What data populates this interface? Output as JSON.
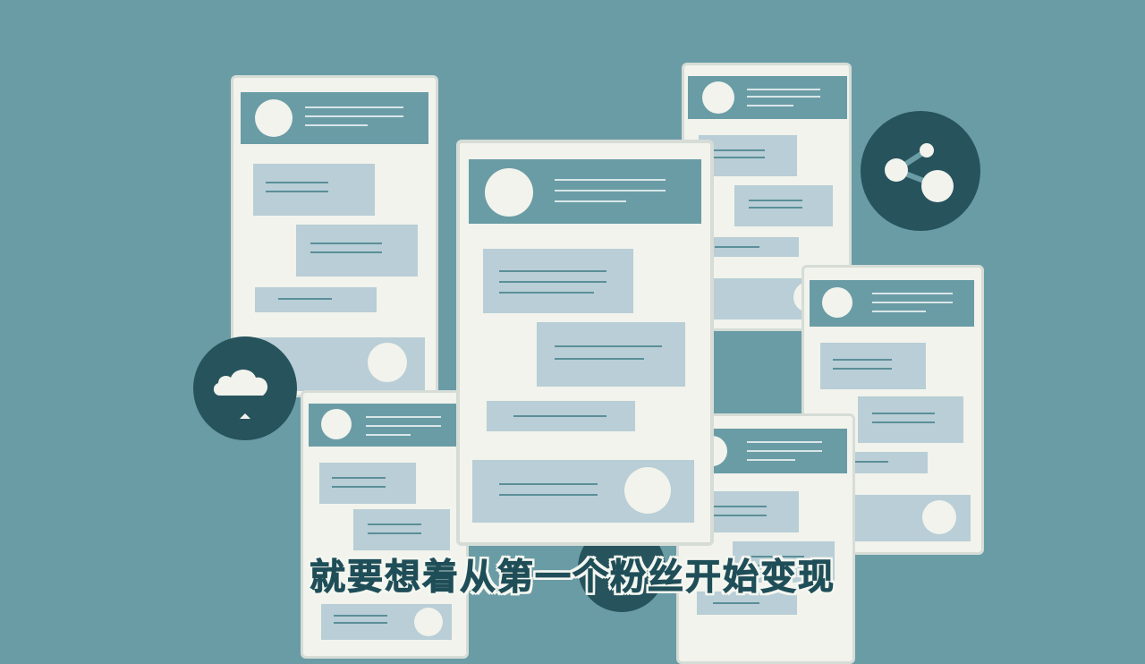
{
  "caption": {
    "text": "就要想着从第一个粉丝开始变现"
  },
  "colors": {
    "background": "#6a9ca6",
    "card": "#f1f3ec",
    "bubble": "#b9ced6",
    "dark_badge": "#27535d",
    "caption_text": "#1f4e58",
    "caption_outline": "#f4f6f0"
  },
  "icons": [
    "cloud-icon",
    "share-icon"
  ]
}
